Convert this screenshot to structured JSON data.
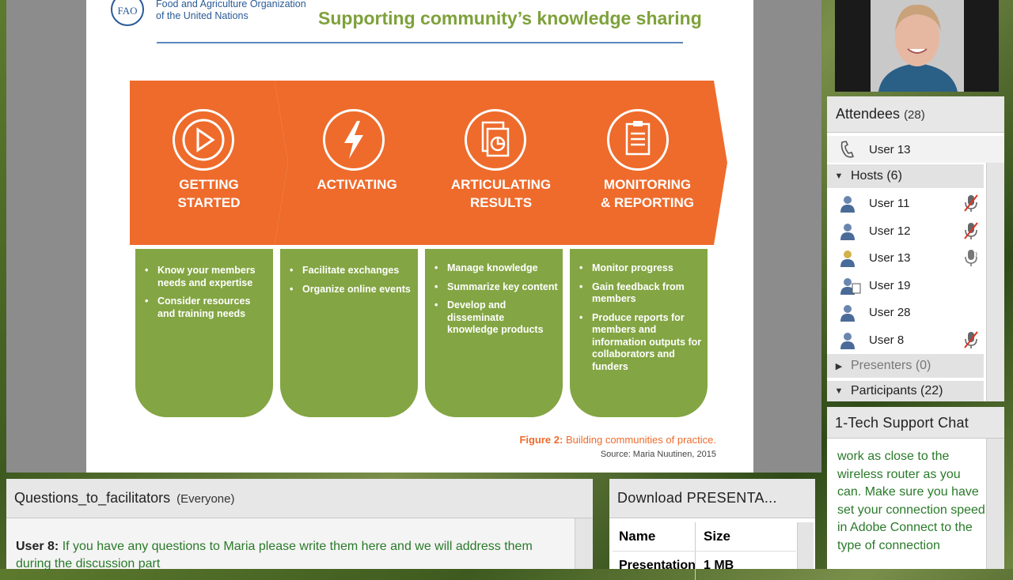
{
  "slide": {
    "org_line1": "Food and Agriculture Organization",
    "org_line2": "of the United Nations",
    "title": "Supporting community’s knowledge sharing",
    "steps": [
      {
        "label_l1": "GETTING",
        "label_l2": "STARTED",
        "icon": "play-icon",
        "bullets": [
          "Know your members needs and expertise",
          "Consider resources and training needs"
        ]
      },
      {
        "label_l1": "ACTIVATING",
        "label_l2": "",
        "icon": "lightning-icon",
        "bullets": [
          "Facilitate exchanges",
          "Organize online events"
        ]
      },
      {
        "label_l1": "ARTICULATING",
        "label_l2": "RESULTS",
        "icon": "document-chart-icon",
        "bullets": [
          "Manage knowledge",
          "Summarize key content",
          "Develop and disseminate knowledge products"
        ]
      },
      {
        "label_l1": "MONITORING",
        "label_l2": "& REPORTING",
        "icon": "clipboard-icon",
        "bullets": [
          "Monitor progress",
          "Gain feedback from members",
          "Produce reports for members and information outputs for collaborators and funders"
        ]
      }
    ],
    "figure_label": "Figure 2:",
    "figure_caption": " Building communities of practice.",
    "source": "Source: Maria Nuutinen, 2015"
  },
  "questions_pod": {
    "title": "Questions_to_facilitators",
    "audience": "(Everyone)",
    "message_author": "User 8:",
    "message_text": " If you have any questions to Maria please write them here and we will address them during the discussion part"
  },
  "download_pod": {
    "title": "Download PRESENTA...",
    "col_name": "Name",
    "col_size": "Size",
    "rows": [
      {
        "name": "Presentation",
        "size": "1 MB"
      }
    ]
  },
  "attendees_pod": {
    "title": "Attendees",
    "count": "(28)",
    "phone_user": "User 13",
    "hosts_label": "Hosts (6)",
    "hosts": [
      {
        "name": "User 11",
        "mic": "mic-muted-icon"
      },
      {
        "name": "User 12",
        "mic": "mic-muted-icon"
      },
      {
        "name": "User 13",
        "mic": "mic-active-icon"
      },
      {
        "name": "User 19",
        "mic": ""
      },
      {
        "name": "User 28",
        "mic": ""
      },
      {
        "name": "User 8",
        "mic": "mic-muted-icon"
      }
    ],
    "presenters_label": "Presenters (0)",
    "participants_label": "Participants (22)"
  },
  "chat_pod": {
    "title": "1-Tech Support Chat",
    "text": "work as close to the wireless router as you can.  Make sure you have set your connection speed in Adobe Connect to the type of connection"
  },
  "colors": {
    "orange": "#ee6b2c",
    "green": "#83a543",
    "title_green": "#7ea13a",
    "chat_text": "#2a7a2a"
  }
}
